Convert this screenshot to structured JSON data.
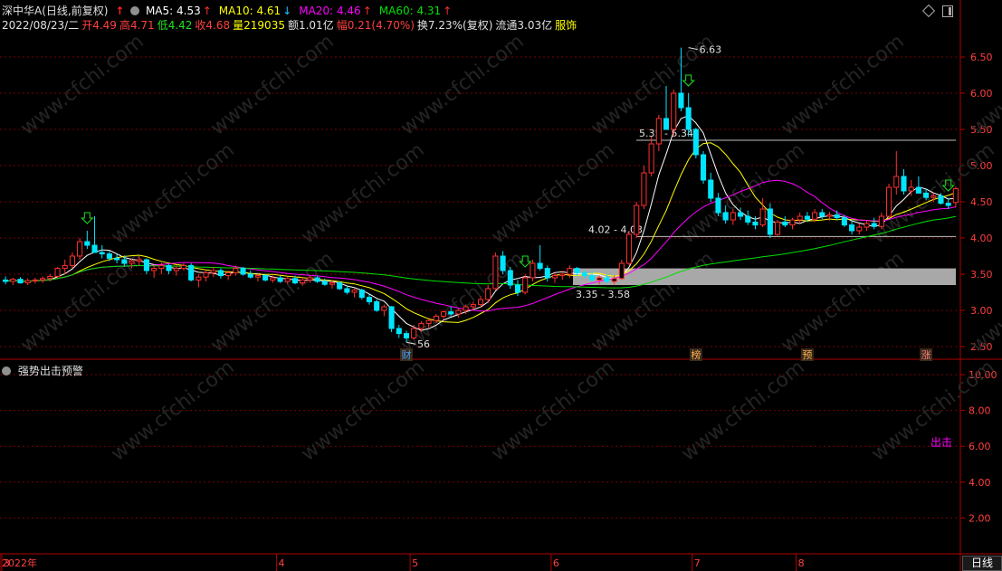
{
  "header": {
    "stock": "深中华A(日线,前复权)",
    "ma_items": [
      {
        "label": "MA5: 4.53",
        "arrow": "↑",
        "color": "#ffffff"
      },
      {
        "label": "MA10: 4.61",
        "arrow": "↓",
        "color": "#ffff00"
      },
      {
        "label": "MA20: 4.46",
        "arrow": "↑",
        "color": "#ff00ff"
      },
      {
        "label": "MA60: 4.31",
        "arrow": "↑",
        "color": "#00e000"
      }
    ],
    "info_items": [
      {
        "text": "2022/08/23/二",
        "color": "#e0e0e0"
      },
      {
        "text": "开4.49",
        "color": "#ff4040"
      },
      {
        "text": "高4.71",
        "color": "#ff4040"
      },
      {
        "text": "低4.42",
        "color": "#20e020"
      },
      {
        "text": "收4.68",
        "color": "#ff4040"
      },
      {
        "text": "量219035",
        "color": "#ffff00"
      },
      {
        "text": "额1.01亿",
        "color": "#e0e0e0"
      },
      {
        "text": "幅0.21(4.70%)",
        "color": "#ff4040"
      },
      {
        "text": "换7.23%(复权)",
        "color": "#e0e0e0"
      },
      {
        "text": "流通3.03亿",
        "color": "#e0e0e0"
      },
      {
        "text": "服饰",
        "color": "#ffff00"
      }
    ]
  },
  "indicator": {
    "title": "强势出击预警",
    "signal_label": "出击"
  },
  "bottom_axis": {
    "period_label": "日线",
    "month_labels": [
      "2022年",
      "3",
      "4",
      "5",
      "6",
      "7",
      "8"
    ]
  },
  "watermark": "www.cfchi.com",
  "chart_data": [
    {
      "type": "candlestick",
      "title": "深中华A(日线,前复权)",
      "ylim": [
        2.35,
        6.85
      ],
      "yticks": [
        "2.50",
        "3.00",
        "3.50",
        "4.00",
        "4.50",
        "5.00",
        "5.50",
        "6.00",
        "6.50"
      ],
      "ohlc": [
        [
          3.42,
          3.47,
          3.36,
          3.4
        ],
        [
          3.4,
          3.45,
          3.35,
          3.43
        ],
        [
          3.43,
          3.46,
          3.37,
          3.38
        ],
        [
          3.38,
          3.44,
          3.35,
          3.41
        ],
        [
          3.41,
          3.45,
          3.37,
          3.42
        ],
        [
          3.42,
          3.47,
          3.38,
          3.44
        ],
        [
          3.44,
          3.5,
          3.4,
          3.47
        ],
        [
          3.47,
          3.6,
          3.45,
          3.58
        ],
        [
          3.58,
          3.7,
          3.5,
          3.62
        ],
        [
          3.62,
          3.8,
          3.58,
          3.75
        ],
        [
          3.75,
          4.0,
          3.7,
          3.95
        ],
        [
          3.95,
          4.1,
          3.85,
          3.9
        ],
        [
          3.9,
          4.3,
          3.85,
          3.8
        ],
        [
          3.8,
          3.9,
          3.72,
          3.78
        ],
        [
          3.78,
          3.82,
          3.68,
          3.72
        ],
        [
          3.72,
          3.78,
          3.65,
          3.7
        ],
        [
          3.7,
          3.76,
          3.6,
          3.65
        ],
        [
          3.65,
          3.72,
          3.58,
          3.68
        ],
        [
          3.68,
          3.75,
          3.62,
          3.7
        ],
        [
          3.7,
          3.72,
          3.5,
          3.55
        ],
        [
          3.55,
          3.62,
          3.45,
          3.58
        ],
        [
          3.58,
          3.66,
          3.5,
          3.62
        ],
        [
          3.62,
          3.64,
          3.5,
          3.55
        ],
        [
          3.55,
          3.62,
          3.48,
          3.58
        ],
        [
          3.58,
          3.65,
          3.55,
          3.62
        ],
        [
          3.62,
          3.65,
          3.4,
          3.42
        ],
        [
          3.42,
          3.5,
          3.32,
          3.46
        ],
        [
          3.46,
          3.56,
          3.4,
          3.52
        ],
        [
          3.52,
          3.6,
          3.46,
          3.55
        ],
        [
          3.55,
          3.58,
          3.44,
          3.48
        ],
        [
          3.48,
          3.55,
          3.42,
          3.52
        ],
        [
          3.52,
          3.62,
          3.48,
          3.58
        ],
        [
          3.58,
          3.6,
          3.48,
          3.5
        ],
        [
          3.5,
          3.55,
          3.44,
          3.46
        ],
        [
          3.46,
          3.52,
          3.4,
          3.48
        ],
        [
          3.48,
          3.5,
          3.4,
          3.42
        ],
        [
          3.42,
          3.48,
          3.38,
          3.45
        ],
        [
          3.45,
          3.48,
          3.38,
          3.4
        ],
        [
          3.4,
          3.46,
          3.36,
          3.44
        ],
        [
          3.44,
          3.48,
          3.36,
          3.38
        ],
        [
          3.38,
          3.46,
          3.34,
          3.42
        ],
        [
          3.42,
          3.48,
          3.38,
          3.45
        ],
        [
          3.45,
          3.48,
          3.38,
          3.4
        ],
        [
          3.4,
          3.44,
          3.34,
          3.36
        ],
        [
          3.36,
          3.42,
          3.3,
          3.38
        ],
        [
          3.38,
          3.4,
          3.28,
          3.3
        ],
        [
          3.3,
          3.34,
          3.22,
          3.25
        ],
        [
          3.25,
          3.3,
          3.18,
          3.28
        ],
        [
          3.28,
          3.3,
          3.15,
          3.18
        ],
        [
          3.18,
          3.22,
          3.08,
          3.12
        ],
        [
          3.12,
          3.15,
          2.98,
          3.0
        ],
        [
          3.0,
          3.08,
          2.92,
          3.05
        ],
        [
          3.05,
          3.06,
          2.7,
          2.75
        ],
        [
          2.75,
          2.8,
          2.62,
          2.68
        ],
        [
          2.68,
          2.72,
          2.56,
          2.62
        ],
        [
          2.62,
          2.8,
          2.6,
          2.75
        ],
        [
          2.75,
          2.85,
          2.7,
          2.82
        ],
        [
          2.82,
          2.9,
          2.76,
          2.86
        ],
        [
          2.86,
          2.95,
          2.82,
          2.92
        ],
        [
          2.92,
          3.0,
          2.88,
          2.98
        ],
        [
          2.98,
          3.05,
          2.92,
          2.95
        ],
        [
          2.95,
          3.02,
          2.9,
          3.0
        ],
        [
          3.0,
          3.08,
          2.95,
          3.05
        ],
        [
          3.05,
          3.12,
          3.0,
          3.08
        ],
        [
          3.08,
          3.2,
          3.04,
          3.15
        ],
        [
          3.15,
          3.35,
          3.1,
          3.3
        ],
        [
          3.3,
          3.8,
          3.28,
          3.75
        ],
        [
          3.75,
          3.82,
          3.5,
          3.55
        ],
        [
          3.55,
          3.6,
          3.3,
          3.35
        ],
        [
          3.35,
          3.42,
          3.2,
          3.25
        ],
        [
          3.25,
          3.5,
          3.22,
          3.45
        ],
        [
          3.45,
          3.7,
          3.4,
          3.65
        ],
        [
          3.65,
          3.9,
          3.55,
          3.58
        ],
        [
          3.58,
          3.62,
          3.4,
          3.45
        ],
        [
          3.45,
          3.52,
          3.38,
          3.48
        ],
        [
          3.48,
          3.55,
          3.42,
          3.5
        ],
        [
          3.5,
          3.62,
          3.45,
          3.58
        ],
        [
          3.58,
          3.6,
          3.48,
          3.52
        ],
        [
          3.52,
          3.56,
          3.44,
          3.48
        ],
        [
          3.48,
          3.55,
          3.4,
          3.42
        ],
        [
          3.42,
          3.48,
          3.36,
          3.45
        ],
        [
          3.45,
          3.5,
          3.38,
          3.4
        ],
        [
          3.4,
          3.48,
          3.36,
          3.44
        ],
        [
          3.44,
          3.7,
          3.42,
          3.65
        ],
        [
          3.65,
          4.1,
          3.62,
          4.05
        ],
        [
          4.05,
          4.5,
          4.0,
          4.45
        ],
        [
          4.45,
          5.0,
          4.4,
          4.9
        ],
        [
          4.9,
          5.4,
          4.85,
          5.3
        ],
        [
          5.3,
          5.7,
          5.2,
          5.65
        ],
        [
          5.65,
          6.1,
          5.55,
          5.5
        ],
        [
          5.5,
          6.05,
          5.4,
          6.0
        ],
        [
          6.0,
          6.63,
          5.75,
          5.8
        ],
        [
          5.8,
          6.0,
          5.4,
          5.5
        ],
        [
          5.5,
          5.52,
          5.1,
          5.15
        ],
        [
          5.15,
          5.2,
          4.75,
          4.8
        ],
        [
          4.8,
          4.9,
          4.5,
          4.55
        ],
        [
          4.55,
          4.62,
          4.3,
          4.35
        ],
        [
          4.35,
          4.45,
          4.2,
          4.25
        ],
        [
          4.25,
          4.4,
          4.18,
          4.35
        ],
        [
          4.35,
          4.42,
          4.25,
          4.3
        ],
        [
          4.3,
          4.38,
          4.18,
          4.22
        ],
        [
          4.22,
          4.3,
          4.12,
          4.18
        ],
        [
          4.18,
          4.55,
          4.15,
          4.4
        ],
        [
          4.4,
          4.48,
          4.0,
          4.05
        ],
        [
          4.05,
          4.25,
          4.03,
          4.22
        ],
        [
          4.22,
          4.3,
          4.15,
          4.18
        ],
        [
          4.18,
          4.28,
          4.12,
          4.25
        ],
        [
          4.25,
          4.35,
          4.2,
          4.3
        ],
        [
          4.3,
          4.36,
          4.22,
          4.26
        ],
        [
          4.26,
          4.4,
          4.22,
          4.35
        ],
        [
          4.35,
          4.4,
          4.26,
          4.3
        ],
        [
          4.3,
          4.36,
          4.24,
          4.32
        ],
        [
          4.32,
          4.38,
          4.25,
          4.28
        ],
        [
          4.28,
          4.32,
          4.15,
          4.18
        ],
        [
          4.18,
          4.25,
          4.05,
          4.1
        ],
        [
          4.1,
          4.2,
          4.05,
          4.15
        ],
        [
          4.15,
          4.24,
          4.1,
          4.2
        ],
        [
          4.2,
          4.28,
          4.12,
          4.16
        ],
        [
          4.16,
          4.35,
          4.12,
          4.3
        ],
        [
          4.3,
          4.75,
          4.28,
          4.7
        ],
        [
          4.7,
          5.2,
          4.6,
          4.85
        ],
        [
          4.85,
          4.95,
          4.6,
          4.65
        ],
        [
          4.65,
          4.8,
          4.58,
          4.7
        ],
        [
          4.7,
          4.85,
          4.62,
          4.62
        ],
        [
          4.62,
          4.68,
          4.52,
          4.56
        ],
        [
          4.56,
          4.62,
          4.5,
          4.58
        ],
        [
          4.58,
          4.62,
          4.46,
          4.48
        ],
        [
          4.48,
          4.55,
          4.4,
          4.45
        ],
        [
          4.49,
          4.71,
          4.42,
          4.68
        ]
      ],
      "ma_series": [
        {
          "name": "MA5",
          "period": 5,
          "color": "#ffffff"
        },
        {
          "name": "MA10",
          "period": 10,
          "color": "#ffff00"
        },
        {
          "name": "MA20",
          "period": 20,
          "color": "#ff00ff"
        },
        {
          "name": "MA60",
          "period": 60,
          "color": "#00e000"
        }
      ],
      "price_levels": [
        {
          "label": "5.35 - 5.34",
          "value": 5.35
        },
        {
          "label": "4.02 - 4.03",
          "value": 4.02
        },
        {
          "label": "3.35 - 3.58",
          "low": 3.35,
          "high": 3.58
        }
      ],
      "extreme_labels": [
        {
          "text": "6.63",
          "index": 92,
          "value": 6.63
        },
        {
          "text": "56",
          "index": 54,
          "value": 2.56
        }
      ],
      "signal_arrows": [
        11,
        70,
        92,
        127
      ],
      "event_tags": [
        {
          "text": "财",
          "index": 54
        },
        {
          "text": "榜",
          "index": 93
        },
        {
          "text": "预",
          "index": 108
        },
        {
          "text": "涨",
          "index": 124
        }
      ]
    },
    {
      "type": "bar",
      "title": "强势出击预警",
      "ylim": [
        0,
        10
      ],
      "yticks": [
        "2.00",
        "4.00",
        "6.00",
        "8.00",
        "10.00"
      ],
      "signal_index": 136,
      "value": 10
    }
  ]
}
